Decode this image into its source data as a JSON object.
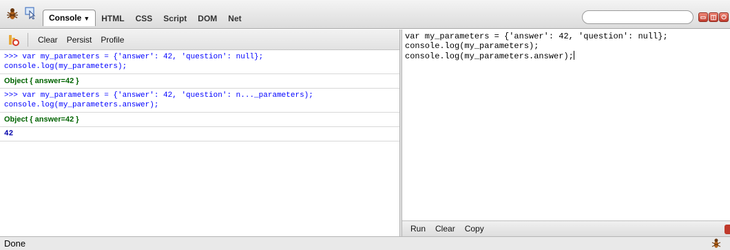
{
  "toolbar": {
    "tabs": [
      {
        "label": "Console",
        "active": true
      },
      {
        "label": "HTML",
        "active": false
      },
      {
        "label": "CSS",
        "active": false
      },
      {
        "label": "Script",
        "active": false
      },
      {
        "label": "DOM",
        "active": false
      },
      {
        "label": "Net",
        "active": false
      }
    ],
    "console_arrow": "▼",
    "search": {
      "value": "",
      "placeholder": ""
    },
    "window_buttons": [
      "▭",
      "◫",
      "⏻"
    ]
  },
  "console": {
    "toolbar": {
      "clear": "Clear",
      "persist": "Persist",
      "profile": "Profile"
    },
    "entries": [
      {
        "type": "cmd",
        "lines": [
          ">>> var my_parameters = {'answer': 42, 'question': null};",
          "console.log(my_parameters);"
        ]
      },
      {
        "type": "obj",
        "lines": [
          "Object { answer=42 }"
        ]
      },
      {
        "type": "cmd",
        "lines": [
          ">>> var my_parameters = {'answer': 42, 'question': n..._parameters);",
          "console.log(my_parameters.answer);"
        ]
      },
      {
        "type": "obj",
        "lines": [
          "Object { answer=42 }"
        ]
      },
      {
        "type": "num",
        "lines": [
          "42"
        ]
      }
    ]
  },
  "editor": {
    "lines": [
      "var my_parameters = {'answer': 42, 'question': null};",
      "console.log(my_parameters);",
      "console.log(my_parameters.answer);"
    ],
    "footer": {
      "run": "Run",
      "clear": "Clear",
      "copy": "Copy"
    }
  },
  "status": {
    "text": "Done"
  },
  "colors": {
    "cmd": "#0000ff",
    "obj": "#006400",
    "close": "#c0392b",
    "clear_icon": "#e8a93a"
  }
}
